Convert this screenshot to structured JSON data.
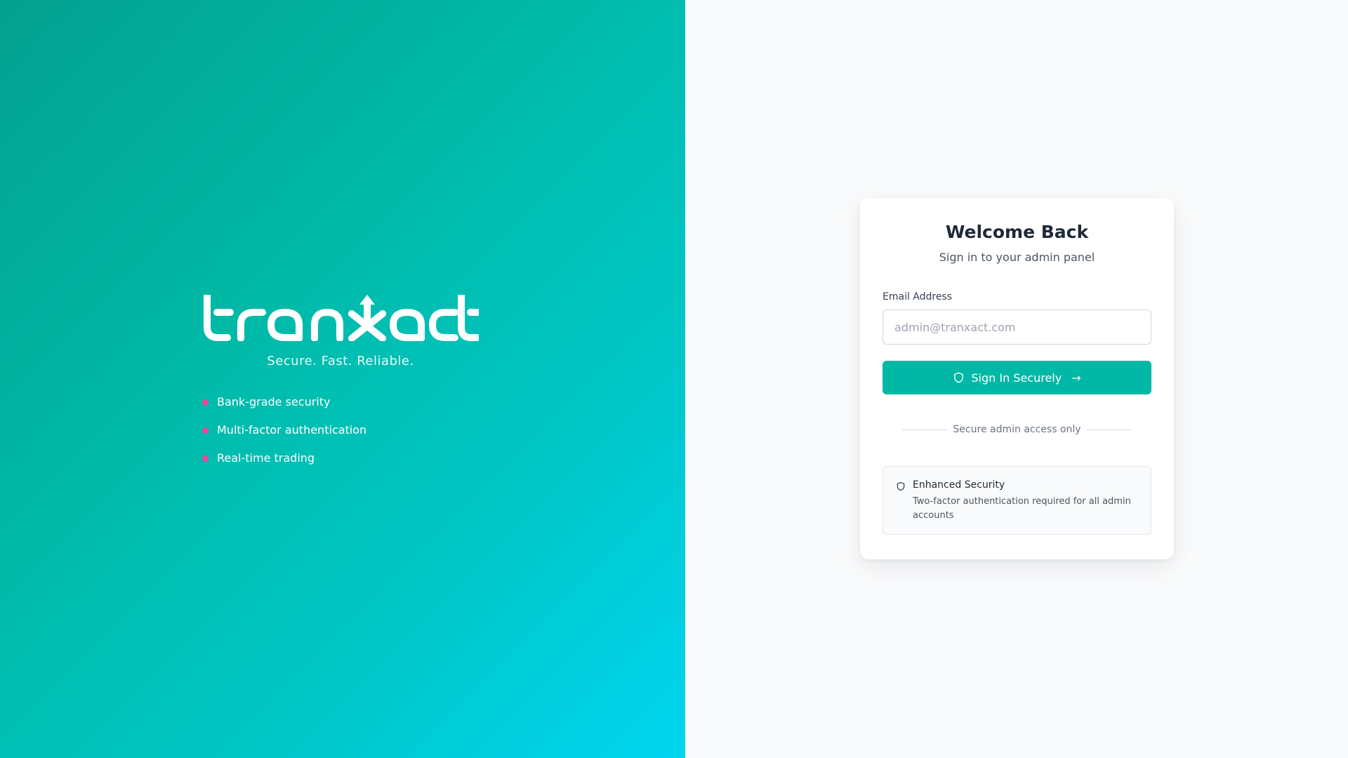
{
  "brand": {
    "logo_text": "tranxact",
    "tagline": "Secure. Fast. Reliable.",
    "features": [
      {
        "label": "Bank-grade security"
      },
      {
        "label": "Multi-factor authentication"
      },
      {
        "label": "Real-time trading"
      }
    ],
    "bullet_color": "#ec4899"
  },
  "login": {
    "title": "Welcome Back",
    "subtitle": "Sign in to your admin panel",
    "email_label": "Email Address",
    "email_placeholder": "admin@tranxact.com",
    "email_value": "",
    "submit_label": "Sign In Securely",
    "submit_icon": "shield-icon",
    "submit_arrow": "→",
    "divider_text": "Secure admin access only",
    "notice": {
      "icon": "shield-icon",
      "title": "Enhanced Security",
      "text": "Two-factor authentication required for all admin accounts"
    }
  },
  "colors": {
    "gradient_start": "#03a090",
    "gradient_end": "#00d4f0",
    "accent": "#00b8a5",
    "page_background": "#f9fafb"
  }
}
